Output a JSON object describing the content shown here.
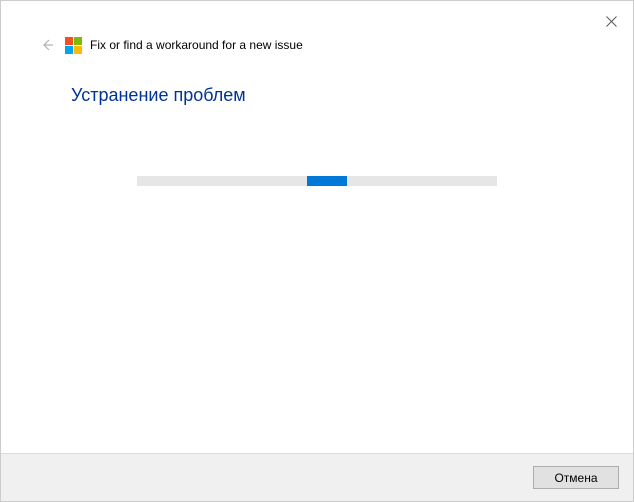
{
  "header": {
    "title": "Fix or find a workaround for a new issue"
  },
  "subtitle": "Устранение проблем",
  "footer": {
    "cancel_label": "Отмена"
  }
}
